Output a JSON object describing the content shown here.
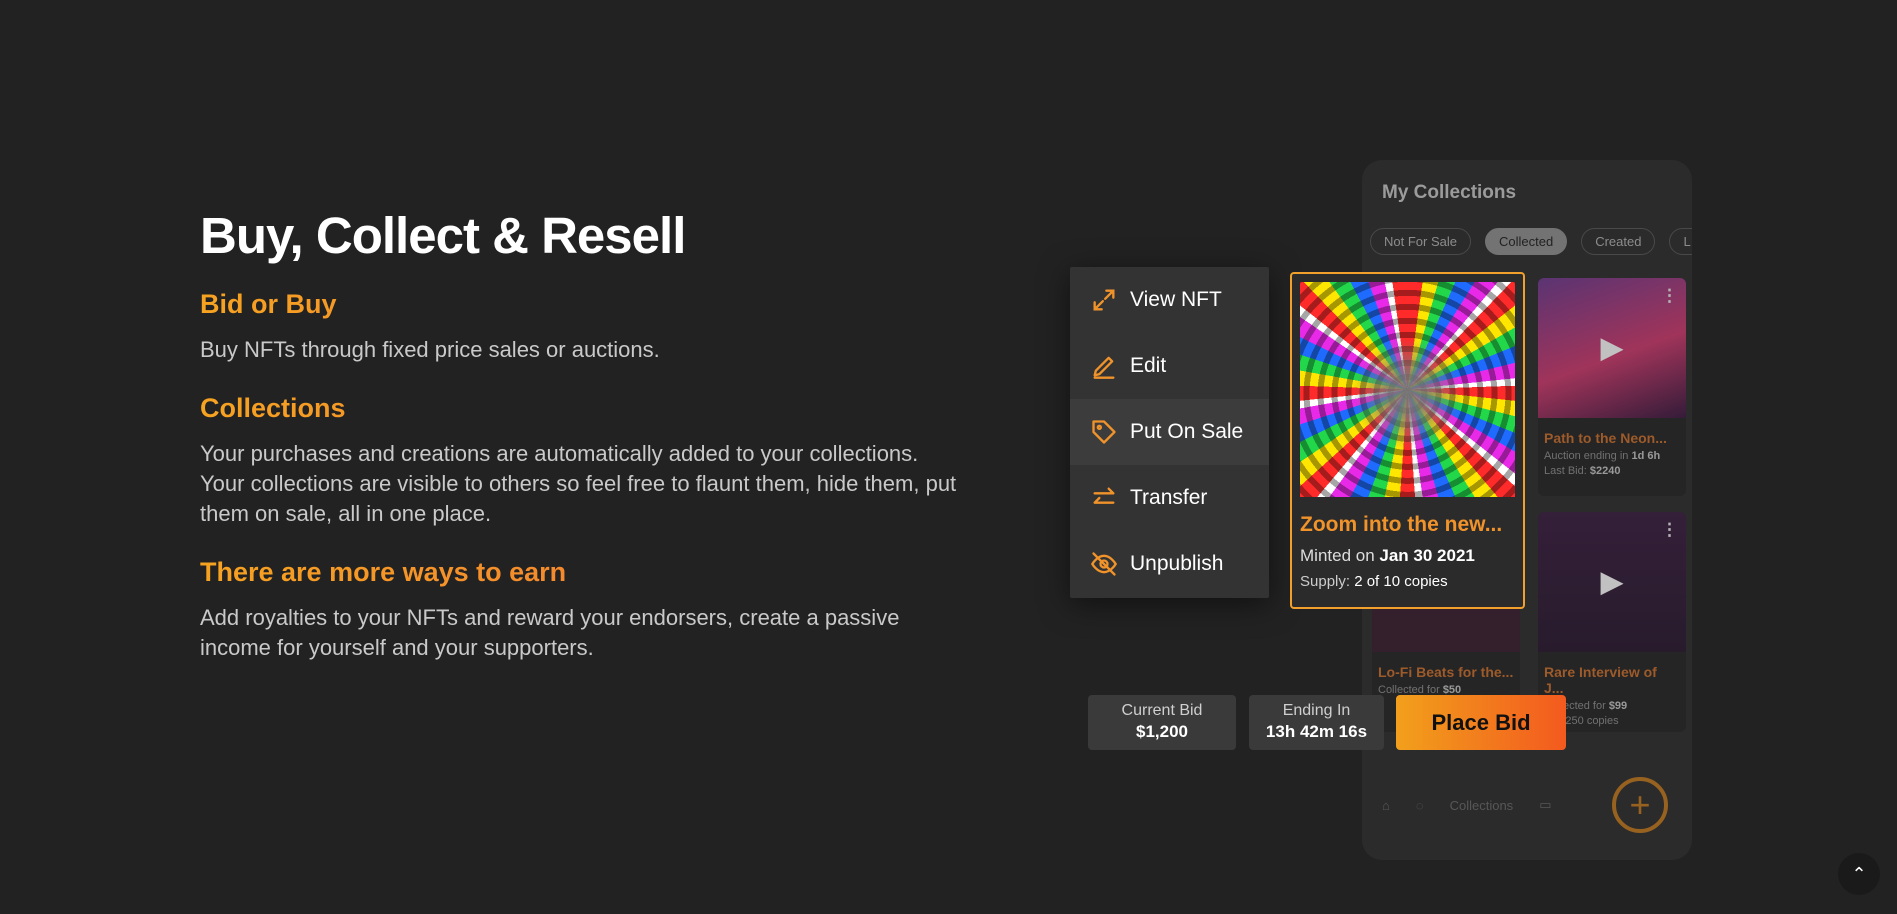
{
  "hero": {
    "title": "Buy, Collect & Resell",
    "sections": [
      {
        "heading": "Bid or Buy",
        "text": "Buy NFTs through fixed price sales or auctions."
      },
      {
        "heading": "Collections",
        "text": "Your purchases and creations are automatically added to your collections. Your collections are visible to others so feel free to flaunt them, hide them, put them on sale, all in one place."
      },
      {
        "heading": "There are more ways to earn",
        "text": "Add royalties to your NFTs and reward your endorsers, create a passive income for yourself and your supporters."
      }
    ]
  },
  "phone": {
    "title": "My Collections",
    "chips": [
      "Not For Sale",
      "Collected",
      "Created",
      "L"
    ],
    "active_chip": "Collected",
    "cards": [
      {
        "name": "Path to the Neon...",
        "line1_prefix": "Auction ending in ",
        "line1_value": "1d 6h",
        "line2_prefix": "Last Bid: ",
        "line2_value": "$2240"
      },
      {
        "name": "Lo-Fi Beats for the...",
        "line1_prefix": "Collected for ",
        "line1_value": "$50",
        "line2_prefix": "",
        "line2_value": ""
      },
      {
        "name": "Rare Interview of J...",
        "line1_prefix": "Collected for ",
        "line1_value": "$99",
        "line2_prefix": "",
        "line2_value": "1 of 250 copies"
      }
    ],
    "nav_label": "Collections"
  },
  "menu": {
    "items": [
      {
        "label": "View NFT",
        "icon": "expand-icon"
      },
      {
        "label": "Edit",
        "icon": "pencil-icon"
      },
      {
        "label": "Put On Sale",
        "icon": "tag-icon"
      },
      {
        "label": "Transfer",
        "icon": "transfer-icon"
      },
      {
        "label": "Unpublish",
        "icon": "eye-off-icon"
      }
    ]
  },
  "nft": {
    "name": "Zoom into the new...",
    "minted_prefix": "Minted on ",
    "minted_date": "Jan 30 2021",
    "supply_prefix": "Supply: ",
    "supply_value": "2 of 10 copies"
  },
  "bid": {
    "current_label": "Current Bid",
    "current_value": "$1,200",
    "ending_label": "Ending In",
    "ending_value": "13h 42m 16s",
    "button": "Place Bid"
  },
  "colors": {
    "accent": "#f0932b",
    "accent_end": "#f35a1e",
    "background": "#222222"
  }
}
